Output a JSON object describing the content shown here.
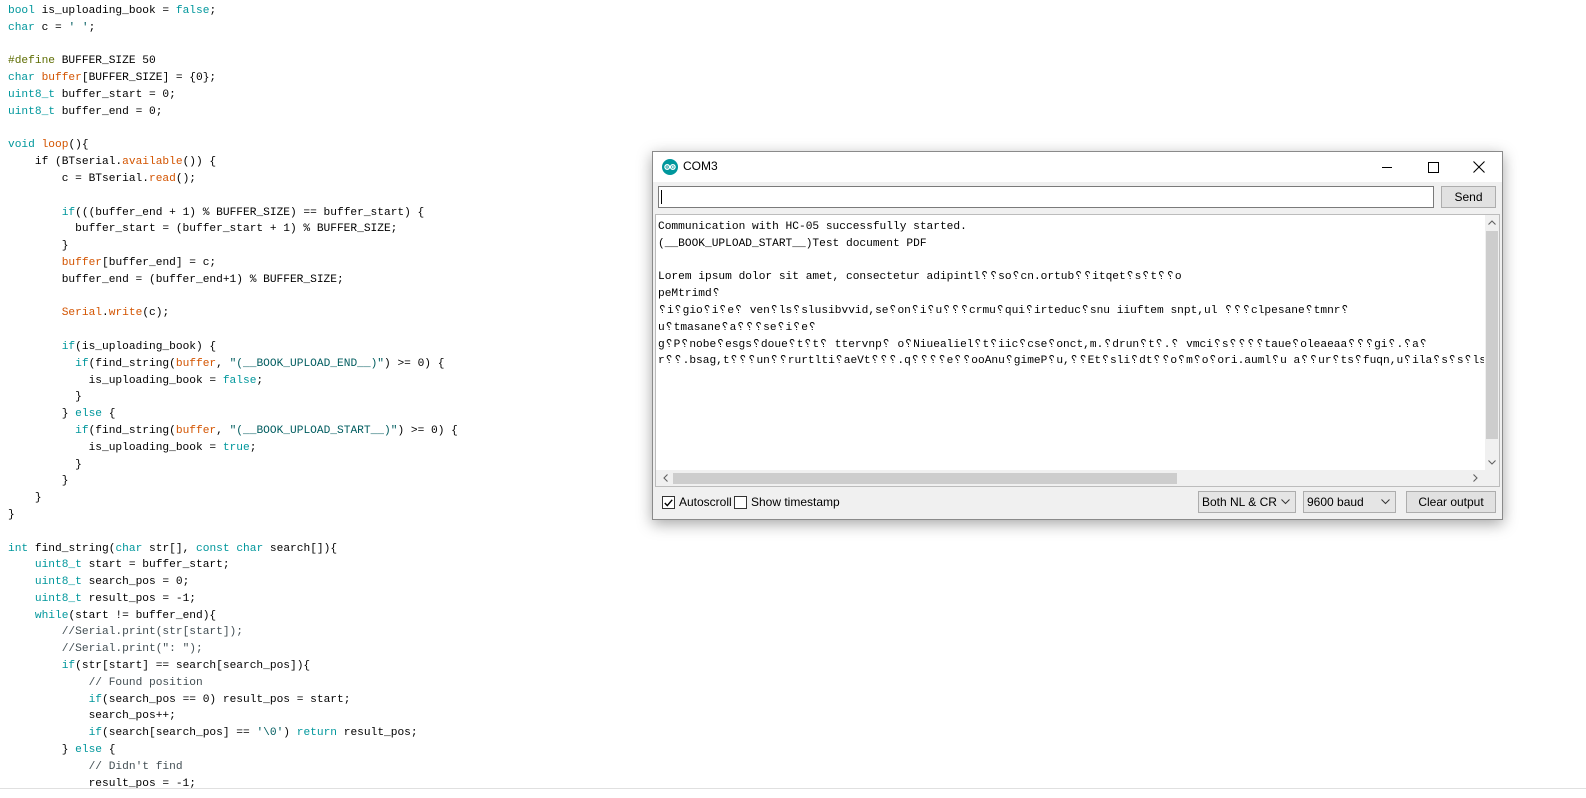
{
  "editor": {
    "lines": [
      [
        [
          "kw",
          "bool"
        ],
        [
          "",
          "is_uploading_book = "
        ],
        [
          "kw",
          "false"
        ],
        [
          "",
          ";"
        ]
      ],
      [
        [
          "kw",
          "char"
        ],
        [
          "",
          "c = "
        ],
        [
          "st",
          "' '"
        ],
        [
          "",
          ";"
        ]
      ],
      [],
      [
        [
          "pp",
          "#define"
        ],
        [
          "",
          "BUFFER_SIZE 50"
        ]
      ],
      [
        [
          "kw",
          "char"
        ],
        [
          "",
          ""
        ],
        [
          "fn",
          "buffer"
        ],
        [
          "",
          "[BUFFER_SIZE] = {0};"
        ]
      ],
      [
        [
          "kw",
          "uint8_t"
        ],
        [
          "",
          "buffer_start = 0;"
        ]
      ],
      [
        [
          "kw",
          "uint8_t"
        ],
        [
          "",
          "buffer_end = 0;"
        ]
      ],
      [],
      [
        [
          "kw",
          "void"
        ],
        [
          "",
          ""
        ],
        [
          "fn",
          "loop"
        ],
        [
          "",
          "(){"
        ]
      ],
      [
        [
          "",
          "    if (BTserial."
        ],
        [
          "fn",
          "available"
        ],
        [
          "",
          "()) {"
        ]
      ],
      [
        [
          "",
          "        c = BTserial."
        ],
        [
          "fn",
          "read"
        ],
        [
          "",
          "();"
        ]
      ],
      [],
      [
        [
          "",
          "        "
        ],
        [
          "kw",
          "if"
        ],
        [
          "",
          "(((buffer_end + 1) % BUFFER_SIZE) == buffer_start) {"
        ]
      ],
      [
        [
          "",
          "          buffer_start = (buffer_start + 1) % BUFFER_SIZE;"
        ]
      ],
      [
        [
          "",
          "        }"
        ]
      ],
      [
        [
          "",
          "        "
        ],
        [
          "fn",
          "buffer"
        ],
        [
          "",
          "[buffer_end] = c;"
        ]
      ],
      [
        [
          "",
          "        buffer_end = (buffer_end+1) % BUFFER_SIZE;"
        ]
      ],
      [],
      [
        [
          "",
          "        "
        ],
        [
          "fn",
          "Serial"
        ],
        [
          "",
          "."
        ],
        [
          "fn",
          "write"
        ],
        [
          "",
          "(c);"
        ]
      ],
      [],
      [
        [
          "",
          "        "
        ],
        [
          "kw",
          "if"
        ],
        [
          "",
          "(is_uploading_book) {"
        ]
      ],
      [
        [
          "",
          "          "
        ],
        [
          "kw",
          "if"
        ],
        [
          "",
          "(find_string("
        ],
        [
          "fn",
          "buffer"
        ],
        [
          "",
          ", "
        ],
        [
          "st",
          "\"(__BOOK_UPLOAD_END__)\""
        ],
        [
          "",
          ") >= 0) {"
        ]
      ],
      [
        [
          "",
          "            is_uploading_book = "
        ],
        [
          "kw",
          "false"
        ],
        [
          "",
          ";"
        ]
      ],
      [
        [
          "",
          "          }"
        ]
      ],
      [
        [
          "",
          "        } "
        ],
        [
          "kw",
          "else"
        ],
        [
          "",
          "{"
        ]
      ],
      [
        [
          "",
          "          "
        ],
        [
          "kw",
          "if"
        ],
        [
          "",
          "(find_string("
        ],
        [
          "fn",
          "buffer"
        ],
        [
          "",
          ", "
        ],
        [
          "st",
          "\"(__BOOK_UPLOAD_START__)\""
        ],
        [
          "",
          ") >= 0) {"
        ]
      ],
      [
        [
          "",
          "            is_uploading_book = "
        ],
        [
          "kw",
          "true"
        ],
        [
          "",
          ";"
        ]
      ],
      [
        [
          "",
          "          }"
        ]
      ],
      [
        [
          "",
          "        }"
        ]
      ],
      [
        [
          "",
          "    }"
        ]
      ],
      [
        [
          "",
          "}"
        ]
      ],
      [],
      [
        [
          "kw",
          "int"
        ],
        [
          "",
          "find_string("
        ],
        [
          "kw",
          "char"
        ],
        [
          "",
          "str[], "
        ],
        [
          "kw",
          "const"
        ],
        [
          "",
          ""
        ],
        [
          "kw",
          "char"
        ],
        [
          "",
          "search[]){"
        ]
      ],
      [
        [
          "",
          "    "
        ],
        [
          "kw",
          "uint8_t"
        ],
        [
          "",
          "start = buffer_start;"
        ]
      ],
      [
        [
          "",
          "    "
        ],
        [
          "kw",
          "uint8_t"
        ],
        [
          "",
          "search_pos = 0;"
        ]
      ],
      [
        [
          "",
          "    "
        ],
        [
          "kw",
          "uint8_t"
        ],
        [
          "",
          "result_pos = -1;"
        ]
      ],
      [
        [
          "",
          "    "
        ],
        [
          "kw",
          "while"
        ],
        [
          "",
          "(start != buffer_end){"
        ]
      ],
      [
        [
          "",
          "        "
        ],
        [
          "cm",
          "//Serial.print(str[start]);"
        ]
      ],
      [
        [
          "",
          "        "
        ],
        [
          "cm",
          "//Serial.print(\": \");"
        ]
      ],
      [
        [
          "",
          "        "
        ],
        [
          "kw",
          "if"
        ],
        [
          "",
          "(str[start] == search[search_pos]){"
        ]
      ],
      [
        [
          "",
          "            "
        ],
        [
          "cm",
          "// Found position"
        ]
      ],
      [
        [
          "",
          "            "
        ],
        [
          "kw",
          "if"
        ],
        [
          "",
          "(search_pos == 0) result_pos = start;"
        ]
      ],
      [
        [
          "",
          "            search_pos++;"
        ]
      ],
      [
        [
          "",
          "            "
        ],
        [
          "kw",
          "if"
        ],
        [
          "",
          "(search[search_pos] == "
        ],
        [
          "st",
          "'\\0'"
        ],
        [
          "",
          ") "
        ],
        [
          "kw",
          "return"
        ],
        [
          "",
          "result_pos;"
        ]
      ],
      [
        [
          "",
          "        } "
        ],
        [
          "kw",
          "else"
        ],
        [
          "",
          "{"
        ]
      ],
      [
        [
          "",
          "            "
        ],
        [
          "cm",
          "// Didn't find"
        ]
      ],
      [
        [
          "",
          "            result_pos = -1;"
        ]
      ]
    ]
  },
  "serial_monitor": {
    "title": "COM3",
    "app_icon": "arduino-logo-icon",
    "window_buttons": [
      "minimize-icon",
      "maximize-icon",
      "close-icon"
    ],
    "input_value": "",
    "send_label": "Send",
    "output": [
      "Communication with HC-05 successfully started.",
      "(__BOOK_UPLOAD_START__)Test document PDF",
      "",
      "Lorem ipsum dolor sit amet, consectetur adipintl␦␦so␦cn.ortub␦␦itqet␦s␦t␦␦o",
      "peMtrimd␦",
      "␦i␦gio␦i␦e␦ ven␦ls␦slusibvvid,se␦on␦i␦u␦␦␦crmu␦qui␦irteduc␦snu iiuftem snpt,ul ␦␦␦clpesane␦tmnr␦",
      "u␦tmasane␦a␦␦␦se␦i␦e␦",
      "g␦P␦nobe␦esgs␦doue␦t␦t␦ ttervnp␦ o␦Niuealiel␦t␦iic␦cse␦onct,m.␦drun␦t␦.␦ vmci␦s␦␦␦␦taue␦oleaeaa␦␦␦gi␦.␦a␦",
      "r␦␦.bsag,t␦␦␦un␦␦rurtlti␦aeVt␦␦␦.q␦␦␦␦e␦␦ooAnu␦gimeP␦u,␦␦Et␦sli␦dt␦␦o␦m␦o␦ori.auml␦u a␦␦ur␦ts␦fuqn,u␦ila␦s␦s␦lsar␦v␦e␦rs␦i naa␦␦vss␦"
    ],
    "autoscroll": {
      "label": "Autoscroll",
      "checked": true
    },
    "show_timestamp": {
      "label": "Show timestamp",
      "checked": false
    },
    "line_ending": "Both NL & CR",
    "baud_rate": "9600 baud",
    "clear_label": "Clear output"
  }
}
